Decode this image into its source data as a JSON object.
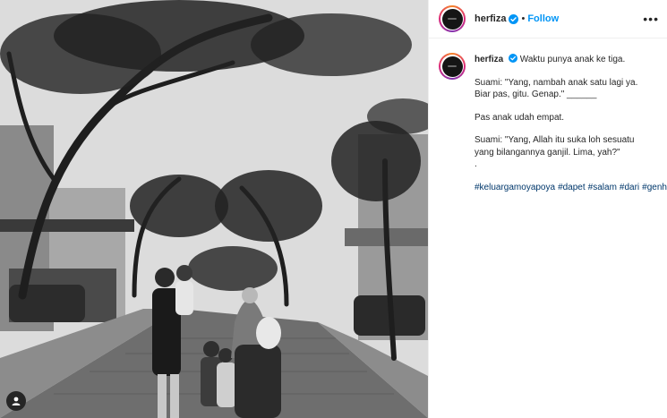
{
  "post": {
    "username": "herfiza",
    "separator": "•",
    "follow_label": "Follow",
    "more_label": "•••"
  },
  "caption": {
    "username": "herfiza",
    "line1": "Waktu punya anak ke tiga.",
    "para2": "Suami: \"Yang, nambah anak satu lagi ya. Biar pas, gitu. Genap.\" ______",
    "para3": "Pas anak udah empat.",
    "para4": "Suami: \"Yang, Allah itu suka loh sesuatu yang bilangannya ganjil. Lima, yah?\"",
    "para5": ".",
    "hashtags": [
      "#keluargamoyapoya",
      "#dapet",
      "#salam",
      "#dari",
      "#genhalilintar"
    ]
  },
  "colors": {
    "follow": "#0095f6",
    "hashtag": "#00376b",
    "text": "#262626"
  },
  "icons": [
    "verified-badge-icon",
    "more-options-icon",
    "user-tag-icon"
  ]
}
